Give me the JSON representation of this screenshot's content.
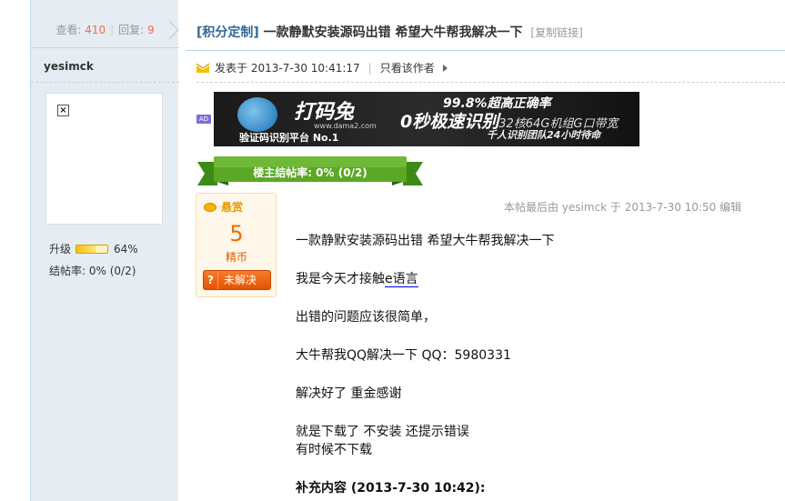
{
  "stats": {
    "views_label": "查看:",
    "views": "410",
    "replies_label": "回复:",
    "replies": "9"
  },
  "user": {
    "name": "yesimck",
    "level_label": "升级",
    "level_percent": "64%",
    "level_fraction": 0.64,
    "close_rate": "结帖率: 0% (0/2)"
  },
  "thread": {
    "category": "[积分定制]",
    "title": "一款静默安装源码出错 希望大牛帮我解决一下",
    "copy_link": "[复制链接]"
  },
  "meta": {
    "posted_prefix": "发表于",
    "posted_time": "2013-7-30 10:41:17",
    "only_author": "只看该作者"
  },
  "ad": {
    "badge": "AD",
    "brand": "打码兔",
    "url": "www.dama2.com",
    "subtitle": "验证码识别平台 No.1",
    "line1": "99.8%超高正确率",
    "line2_main": "0秒极速识别",
    "line2_sub": "32核64G机组G口带宽",
    "line3": "千人识别团队24小时待命"
  },
  "ribbon": {
    "text": "楼主结帖率: 0% (0/2)"
  },
  "reward": {
    "title": "悬赏",
    "amount": "5",
    "unit": "精币",
    "status": "未解决",
    "status_icon": "?"
  },
  "edit_note": "本帖最后由 yesimck 于 2013-7-30 10:50 编辑",
  "post": {
    "line1": "一款静默安装源码出错  希望大牛帮我解决一下",
    "line2_pre": "我是今天才接触",
    "line2_link": "e语言",
    "line3": "出错的问题应该很简单，",
    "line4": "大牛帮我QQ解决一下    QQ：5980331",
    "line5": "解决好了  重金感谢",
    "line6": "就是下载了  不安装  还提示错误",
    "line7": "有时候不下载",
    "line8": "补充内容 (2013-7-30 10:42):"
  },
  "colors": {
    "sidebar_bg": "#e5edf2",
    "accent": "#336699",
    "stat_number": "#f26c4f",
    "reward_orange": "#f26c00",
    "ribbon_green": "#5ba826"
  }
}
